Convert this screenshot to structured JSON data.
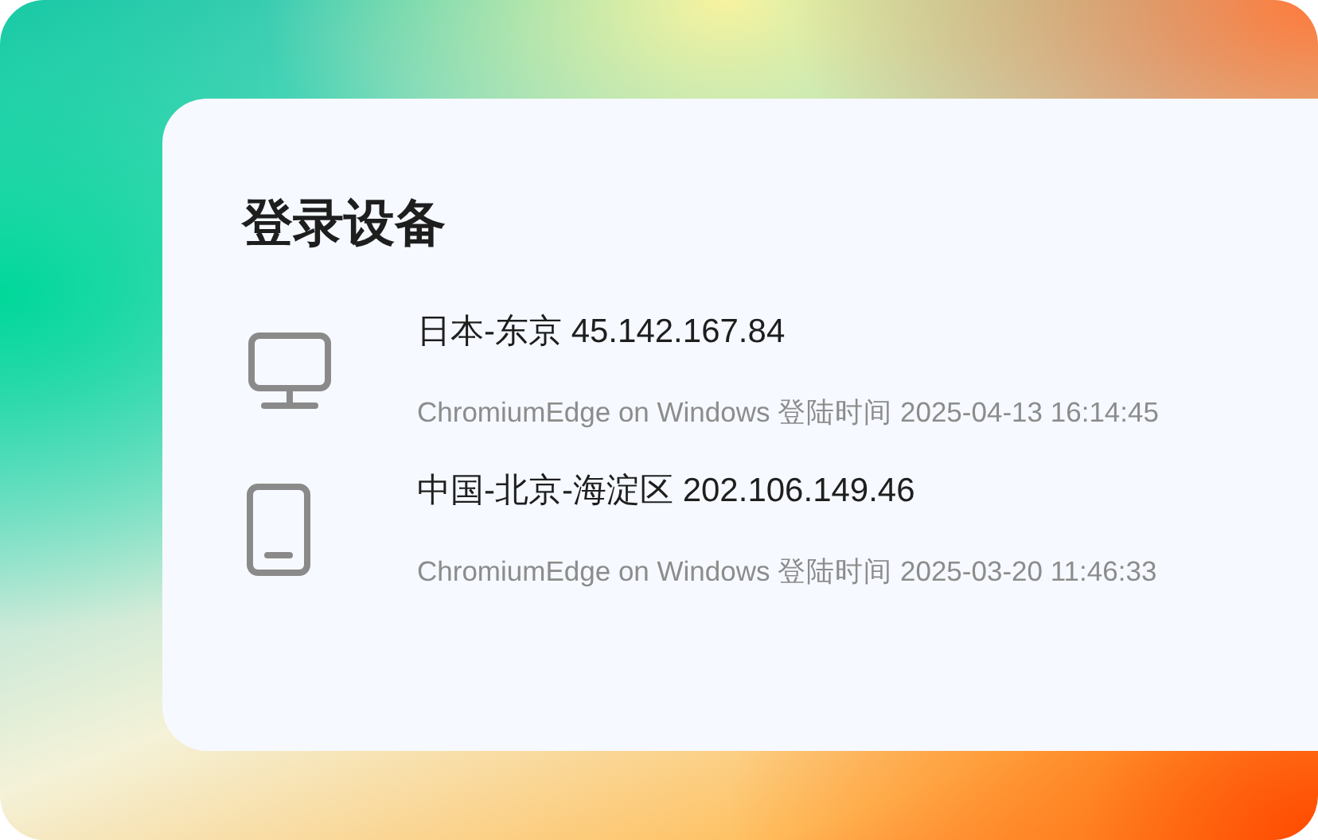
{
  "title": "登录设备",
  "devices": [
    {
      "kind": "desktop",
      "location": "日本-东京 45.142.167.84",
      "detail": "ChromiumEdge on Windows 登陆时间 2025-04-13 16:14:45"
    },
    {
      "kind": "mobile",
      "location": "中国-北京-海淀区 202.106.149.46",
      "detail": "ChromiumEdge on Windows 登陆时间 2025-03-20 11:46:33"
    }
  ]
}
